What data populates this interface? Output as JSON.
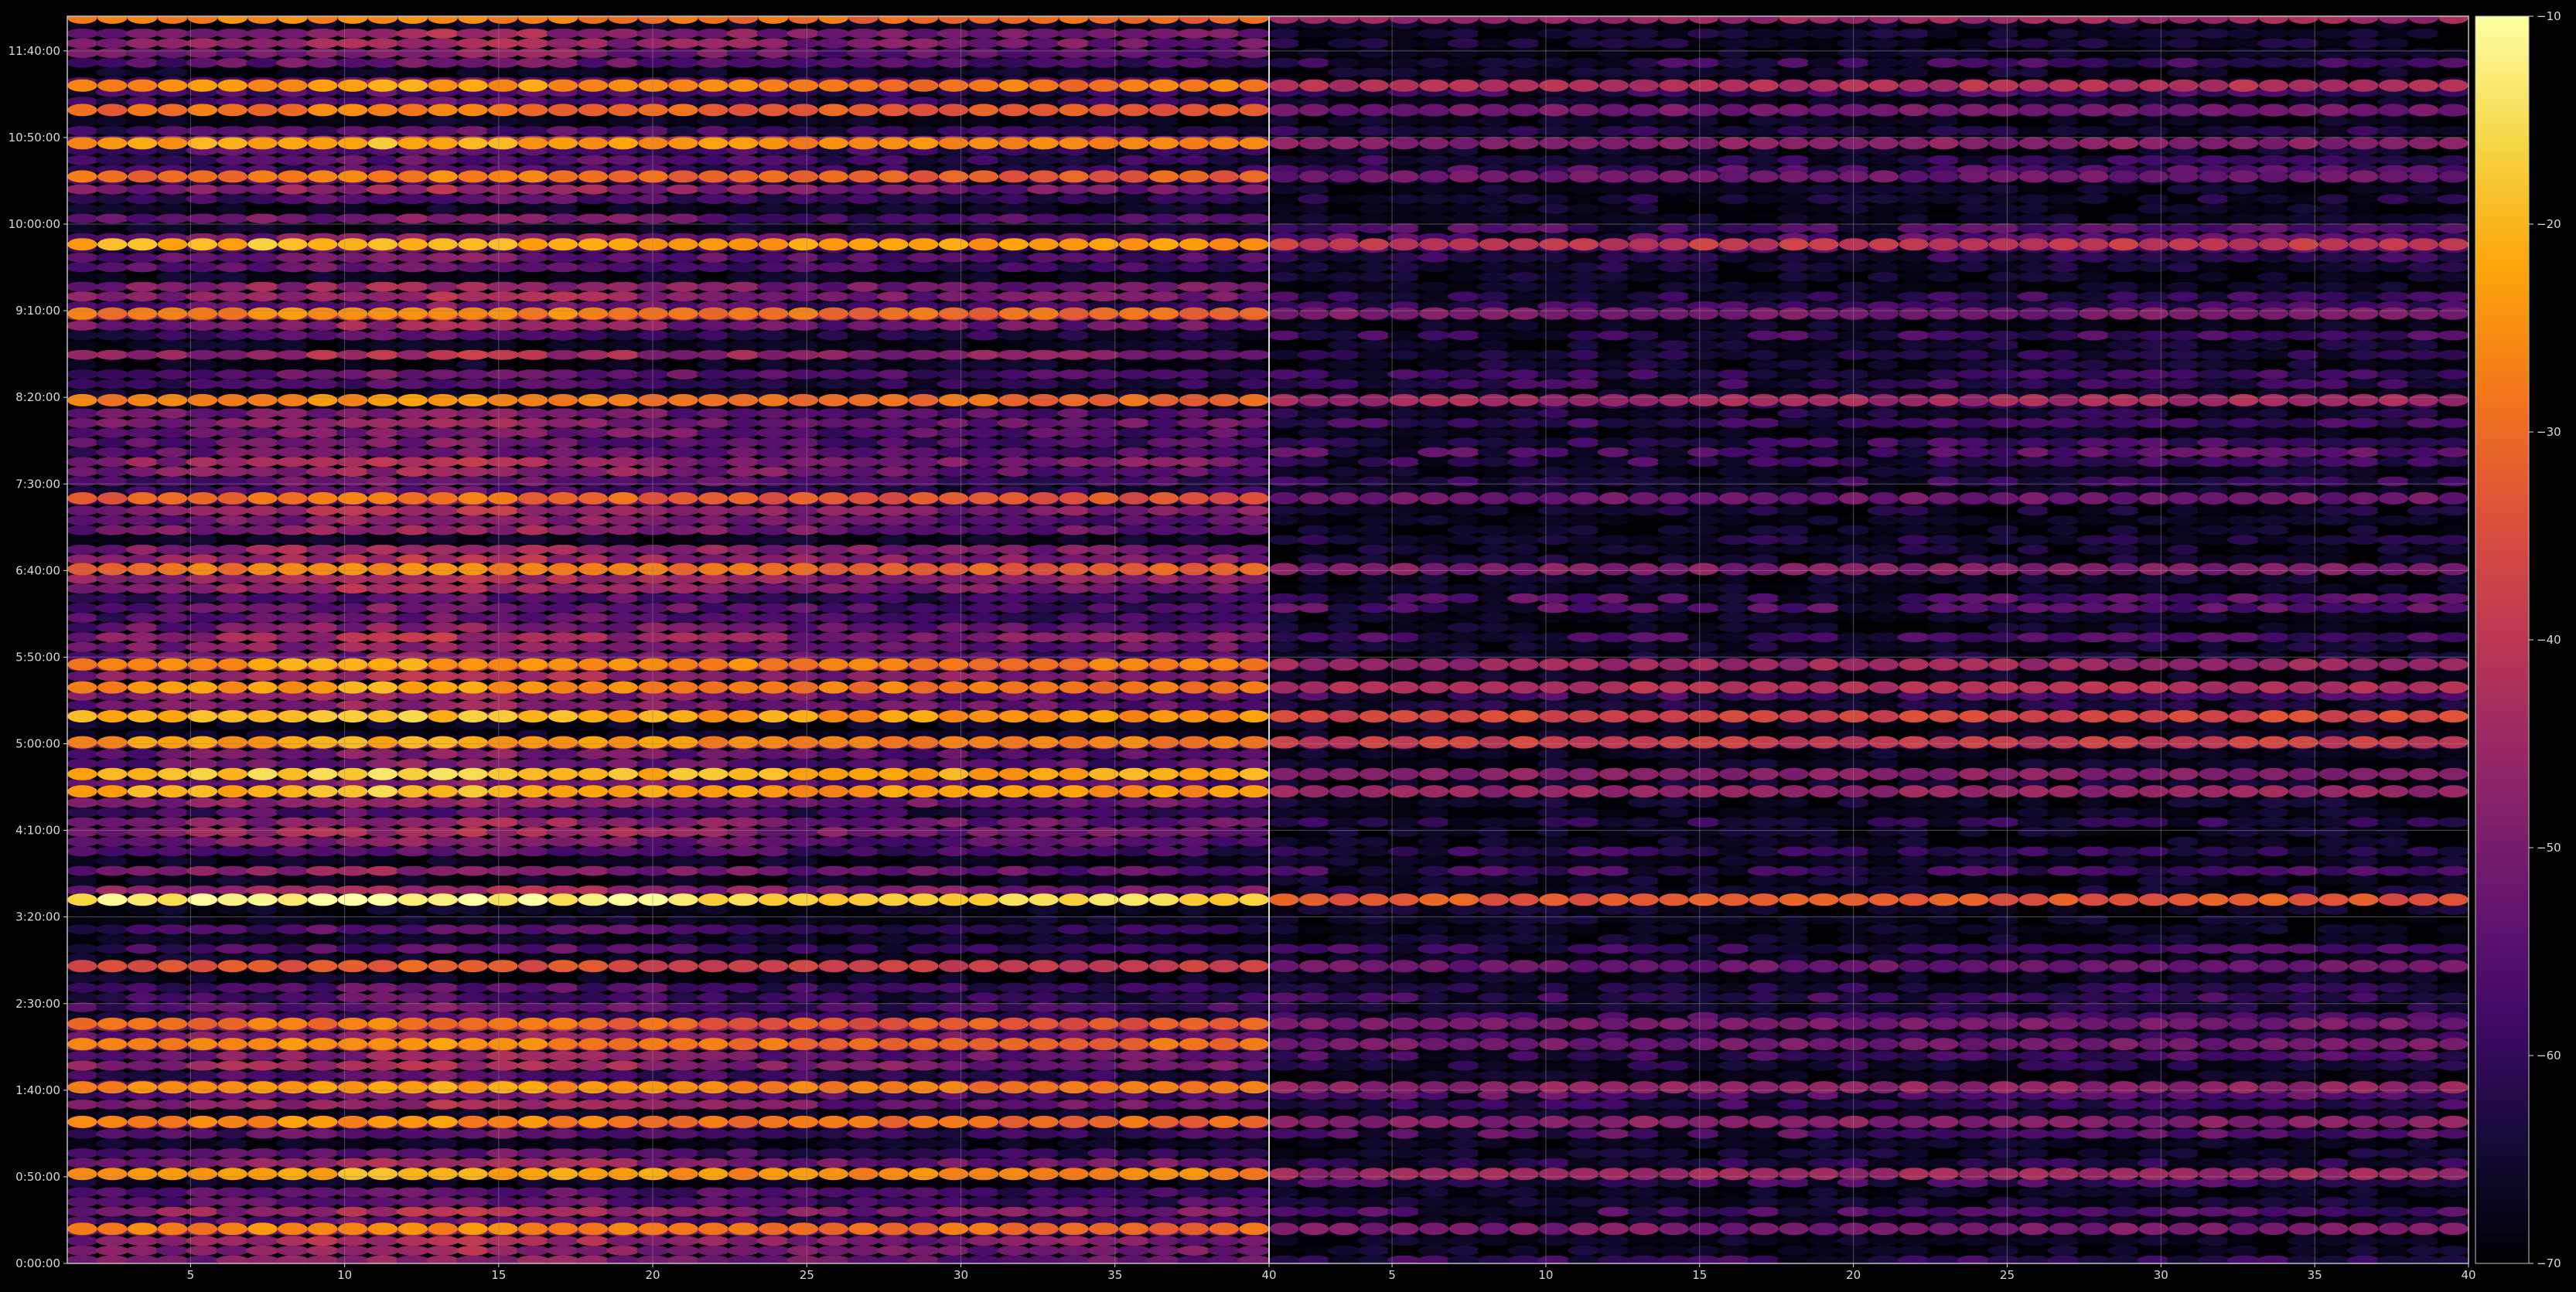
{
  "chart_data": {
    "type": "heatmap",
    "title": "",
    "xlabel": "",
    "ylabel": "",
    "grid": true,
    "panels": [
      {
        "name": "",
        "x_range": [
          1,
          40
        ],
        "x_ticks": [
          5,
          10,
          15,
          20,
          25,
          30,
          35,
          40
        ]
      },
      {
        "name": "",
        "x_range": [
          1,
          40
        ],
        "x_ticks": [
          5,
          10,
          15,
          20,
          25,
          30,
          35,
          40
        ]
      }
    ],
    "y_range_seconds": [
      0,
      43200
    ],
    "y_ticks": [
      {
        "value": 0,
        "label": "0:00:00"
      },
      {
        "value": 3000,
        "label": "0:50:00"
      },
      {
        "value": 6000,
        "label": "1:40:00"
      },
      {
        "value": 9000,
        "label": "2:30:00"
      },
      {
        "value": 12000,
        "label": "3:20:00"
      },
      {
        "value": 15000,
        "label": "4:10:00"
      },
      {
        "value": 18000,
        "label": "5:00:00"
      },
      {
        "value": 21000,
        "label": "5:50:00"
      },
      {
        "value": 24000,
        "label": "6:40:00"
      },
      {
        "value": 27000,
        "label": "7:30:00"
      },
      {
        "value": 30000,
        "label": "8:20:00"
      },
      {
        "value": 33000,
        "label": "9:10:00"
      },
      {
        "value": 36000,
        "label": "10:00:00"
      },
      {
        "value": 39000,
        "label": "10:50:00"
      },
      {
        "value": 42000,
        "label": "11:40:00"
      }
    ],
    "colorbar": {
      "colormap": "inferno",
      "range": [
        -70,
        -10
      ],
      "ticks": [
        -10,
        -20,
        -30,
        -40,
        -50,
        -60,
        -70
      ]
    },
    "strong_rows_seconds": [
      {
        "t": 12600,
        "left": -16,
        "right": -33
      },
      {
        "t": 16350,
        "left": -24,
        "right": -46
      },
      {
        "t": 16950,
        "left": -22,
        "right": -48
      },
      {
        "t": 18050,
        "left": -27,
        "right": -38
      },
      {
        "t": 18950,
        "left": -24,
        "right": -36
      },
      {
        "t": 19950,
        "left": -28,
        "right": -42
      },
      {
        "t": 20750,
        "left": -28,
        "right": -45
      },
      {
        "t": 24050,
        "left": -32,
        "right": -49
      },
      {
        "t": 26500,
        "left": -34,
        "right": -52
      },
      {
        "t": 29900,
        "left": -30,
        "right": -44
      },
      {
        "t": 32900,
        "left": -30,
        "right": -50
      },
      {
        "t": 35300,
        "left": -24,
        "right": -39
      },
      {
        "t": 37650,
        "left": -32,
        "right": -52
      },
      {
        "t": 38800,
        "left": -26,
        "right": -48
      },
      {
        "t": 39950,
        "left": -33,
        "right": -51
      },
      {
        "t": 40800,
        "left": -28,
        "right": -42
      },
      {
        "t": 43150,
        "left": -30,
        "right": -45
      },
      {
        "t": 3100,
        "left": -26,
        "right": -45
      },
      {
        "t": 4900,
        "left": -30,
        "right": -48
      },
      {
        "t": 6100,
        "left": -28,
        "right": -47
      },
      {
        "t": 7600,
        "left": -30,
        "right": -51
      },
      {
        "t": 8300,
        "left": -33,
        "right": -50
      },
      {
        "t": 1200,
        "left": -30,
        "right": -50
      },
      {
        "t": 10300,
        "left": -38,
        "right": -52
      }
    ]
  }
}
